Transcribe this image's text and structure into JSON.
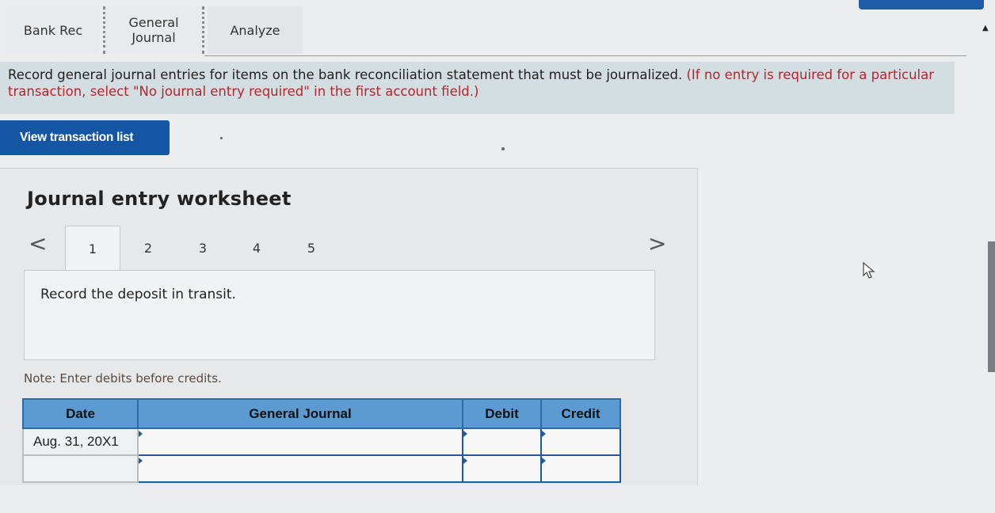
{
  "tabs": [
    {
      "label": "Bank Rec"
    },
    {
      "label": "General Journal"
    },
    {
      "label": "Analyze"
    }
  ],
  "instruction": {
    "plain": "Record general journal entries for items on the bank reconciliation statement that must be journalized.",
    "red": "(If no entry is required for a particular transaction, select \"No journal entry required\" in the first account field.)"
  },
  "view_button_label": "View transaction list",
  "worksheet": {
    "title": "Journal entry worksheet",
    "nav_prev": "<",
    "nav_next": ">",
    "steps": [
      "1",
      "2",
      "3",
      "4",
      "5"
    ],
    "active_step": "1",
    "prompt": "Record the deposit in transit.",
    "note": "Note: Enter debits before credits."
  },
  "table": {
    "headers": {
      "date": "Date",
      "journal": "General Journal",
      "debit": "Debit",
      "credit": "Credit"
    },
    "rows": [
      {
        "date": "Aug. 31, 20X1",
        "account": "",
        "debit": "",
        "credit": ""
      },
      {
        "date": "",
        "account": "",
        "debit": "",
        "credit": ""
      }
    ]
  },
  "colors": {
    "primary_button": "#1556a4",
    "table_header": "#5b9bd2",
    "instruction_red": "#b3262b",
    "banner_bg": "#d3dee3"
  }
}
